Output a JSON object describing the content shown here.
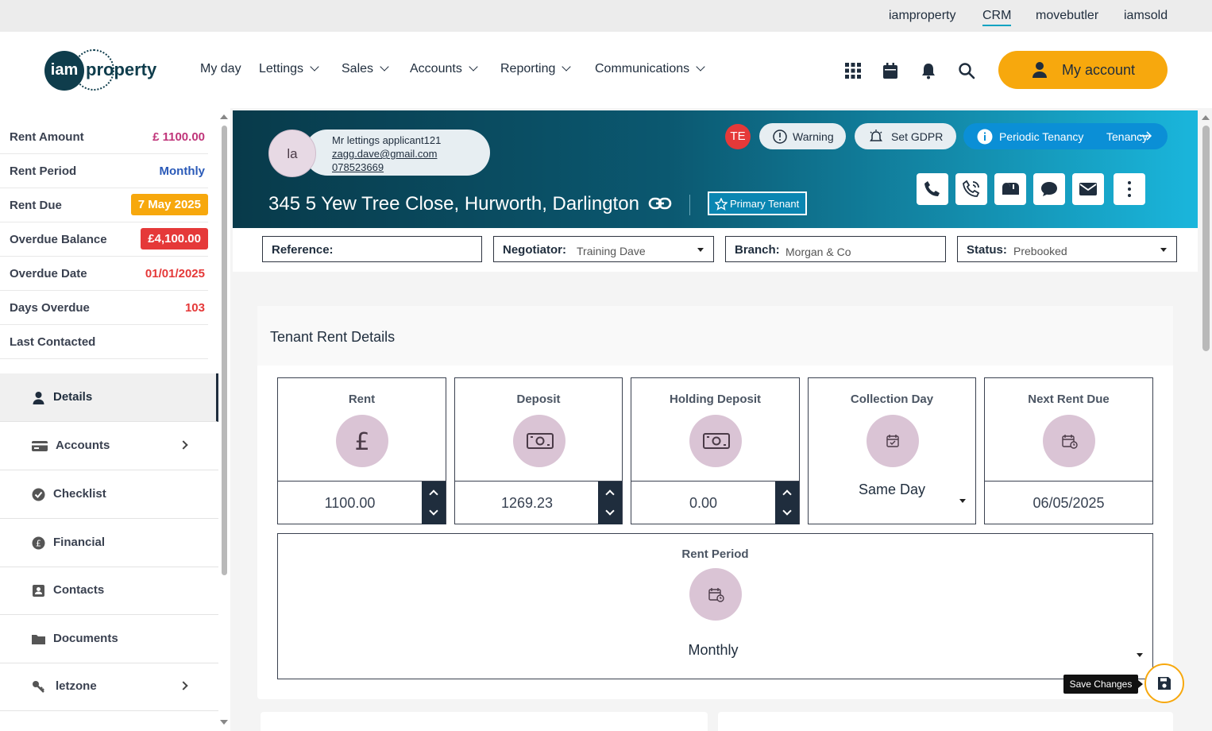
{
  "top_links": [
    "iamproperty",
    "CRM",
    "movebutler",
    "iamsold"
  ],
  "logo": {
    "circle_text": "iam",
    "text": "property"
  },
  "nav": [
    "My day",
    "Lettings",
    "Sales",
    "Accounts",
    "Reporting",
    "Communications"
  ],
  "header_icons": [
    "apps-grid-icon",
    "calendar-icon",
    "bell-icon",
    "search-icon"
  ],
  "account_button": "My account",
  "summary": [
    {
      "label": "Rent Amount",
      "value": "£ 1100.00",
      "color": "#c0357a"
    },
    {
      "label": "Rent Period",
      "value": "Monthly",
      "color": "#2a5ab8"
    },
    {
      "label": "Rent Due",
      "value": "7 May 2025",
      "color": "#f7a80d"
    },
    {
      "label": "Overdue Balance",
      "value": "£4,100.00",
      "color": "#e53939"
    },
    {
      "label": "Overdue Date",
      "value": "01/01/2025",
      "color": "#e53939"
    },
    {
      "label": "Days Overdue",
      "value": "103",
      "color": "#e53939"
    },
    {
      "label": "Last Contacted",
      "value": ""
    }
  ],
  "menu": [
    {
      "label": "Details",
      "icon": "person-icon",
      "active": true
    },
    {
      "label": "Accounts",
      "icon": "card-icon",
      "arrow": true
    },
    {
      "label": "Checklist",
      "icon": "check-circle-icon"
    },
    {
      "label": "Financial",
      "icon": "pound-circle-icon"
    },
    {
      "label": "Contacts",
      "icon": "contact-card-icon"
    },
    {
      "label": "Documents",
      "icon": "folder-icon"
    },
    {
      "label": "letzone",
      "icon": "key-icon",
      "arrow": true
    }
  ],
  "banner": {
    "avatar": "la",
    "name": "Mr lettings applicant121",
    "email": "zagg.dave@gmail.com",
    "phone": "078523669",
    "address": "345 5 Yew Tree Close, Hurworth, Darlington",
    "primary_tenant": "Primary Tenant",
    "initials": "TE",
    "warning": "Warning",
    "gdpr": "Set GDPR",
    "tenancy_type": "Periodic Tenancy",
    "tenancy_link": "Tenancy"
  },
  "filters": {
    "reference": {
      "label": "Reference:",
      "value": ""
    },
    "negotiator": {
      "label": "Negotiator:",
      "value": "Training Dave"
    },
    "branch": {
      "label": "Branch:",
      "value": "Morgan & Co"
    },
    "status": {
      "label": "Status:",
      "value": "Prebooked"
    }
  },
  "card": {
    "title": "Tenant Rent Details",
    "rent": {
      "label": "Rent",
      "value": "1100.00"
    },
    "deposit": {
      "label": "Deposit",
      "value": "1269.23"
    },
    "holding": {
      "label": "Holding Deposit",
      "value": "0.00"
    },
    "collection": {
      "label": "Collection Day",
      "value": "Same Day"
    },
    "next_due": {
      "label": "Next Rent Due",
      "value": "06/05/2025"
    },
    "period": {
      "label": "Rent Period",
      "value": "Monthly"
    }
  },
  "save_tooltip": "Save Changes"
}
